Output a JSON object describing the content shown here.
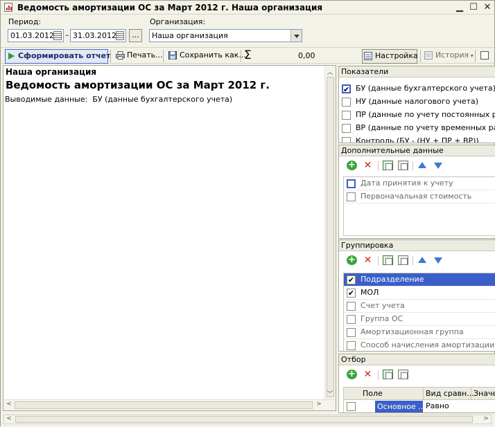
{
  "window": {
    "title": "Ведомость амортизации ОС за Март 2012 г. Наша организация"
  },
  "period": {
    "label": "Период:",
    "start": "01.03.2012",
    "dash": "–",
    "end": "31.03.2012",
    "more": "..."
  },
  "organization": {
    "label": "Организация:",
    "value": "Наша организация"
  },
  "toolbar": {
    "generate": "Сформировать отчет",
    "print": "Печать...",
    "save": "Сохранить как...",
    "sum_symbol": "Σ",
    "sum_value": "0,00",
    "settings": "Настройка",
    "history": "История"
  },
  "report": {
    "org": "Наша организация",
    "title": "Ведомость амортизации ОС за Март 2012 г.",
    "output_label": "Выводимые данные:",
    "output_value": "БУ (данные бухгалтерского учета)"
  },
  "indicators": {
    "header": "Показатели",
    "items": [
      {
        "label": "БУ (данные бухгалтерского учета)",
        "checked": true
      },
      {
        "label": "НУ (данные налогового учета)",
        "checked": false
      },
      {
        "label": "ПР (данные по учету постоянных разн",
        "checked": false
      },
      {
        "label": "ВР (данные по учету временных разн",
        "checked": false
      },
      {
        "label": "Контроль (БУ - (НУ + ПР + ВР))",
        "checked": false
      }
    ]
  },
  "additional": {
    "header": "Дополнительные данные",
    "items": [
      {
        "label": "Дата принятия к учету"
      },
      {
        "label": "Первоначальная стоимость"
      }
    ]
  },
  "grouping": {
    "header": "Группировка",
    "items": [
      {
        "label": "Подразделение",
        "checked": true
      },
      {
        "label": "МОЛ",
        "checked": true
      },
      {
        "label": "Счет учета",
        "checked": false
      },
      {
        "label": "Группа ОС",
        "checked": false
      },
      {
        "label": "Амортизационная группа",
        "checked": false
      },
      {
        "label": "Способ начисления амортизации",
        "checked": false
      }
    ]
  },
  "filter": {
    "header": "Отбор",
    "columns": [
      "Поле",
      "Вид сравн...",
      "Значе"
    ],
    "row": {
      "field": "Основное ...",
      "comparison": "Равно"
    }
  }
}
